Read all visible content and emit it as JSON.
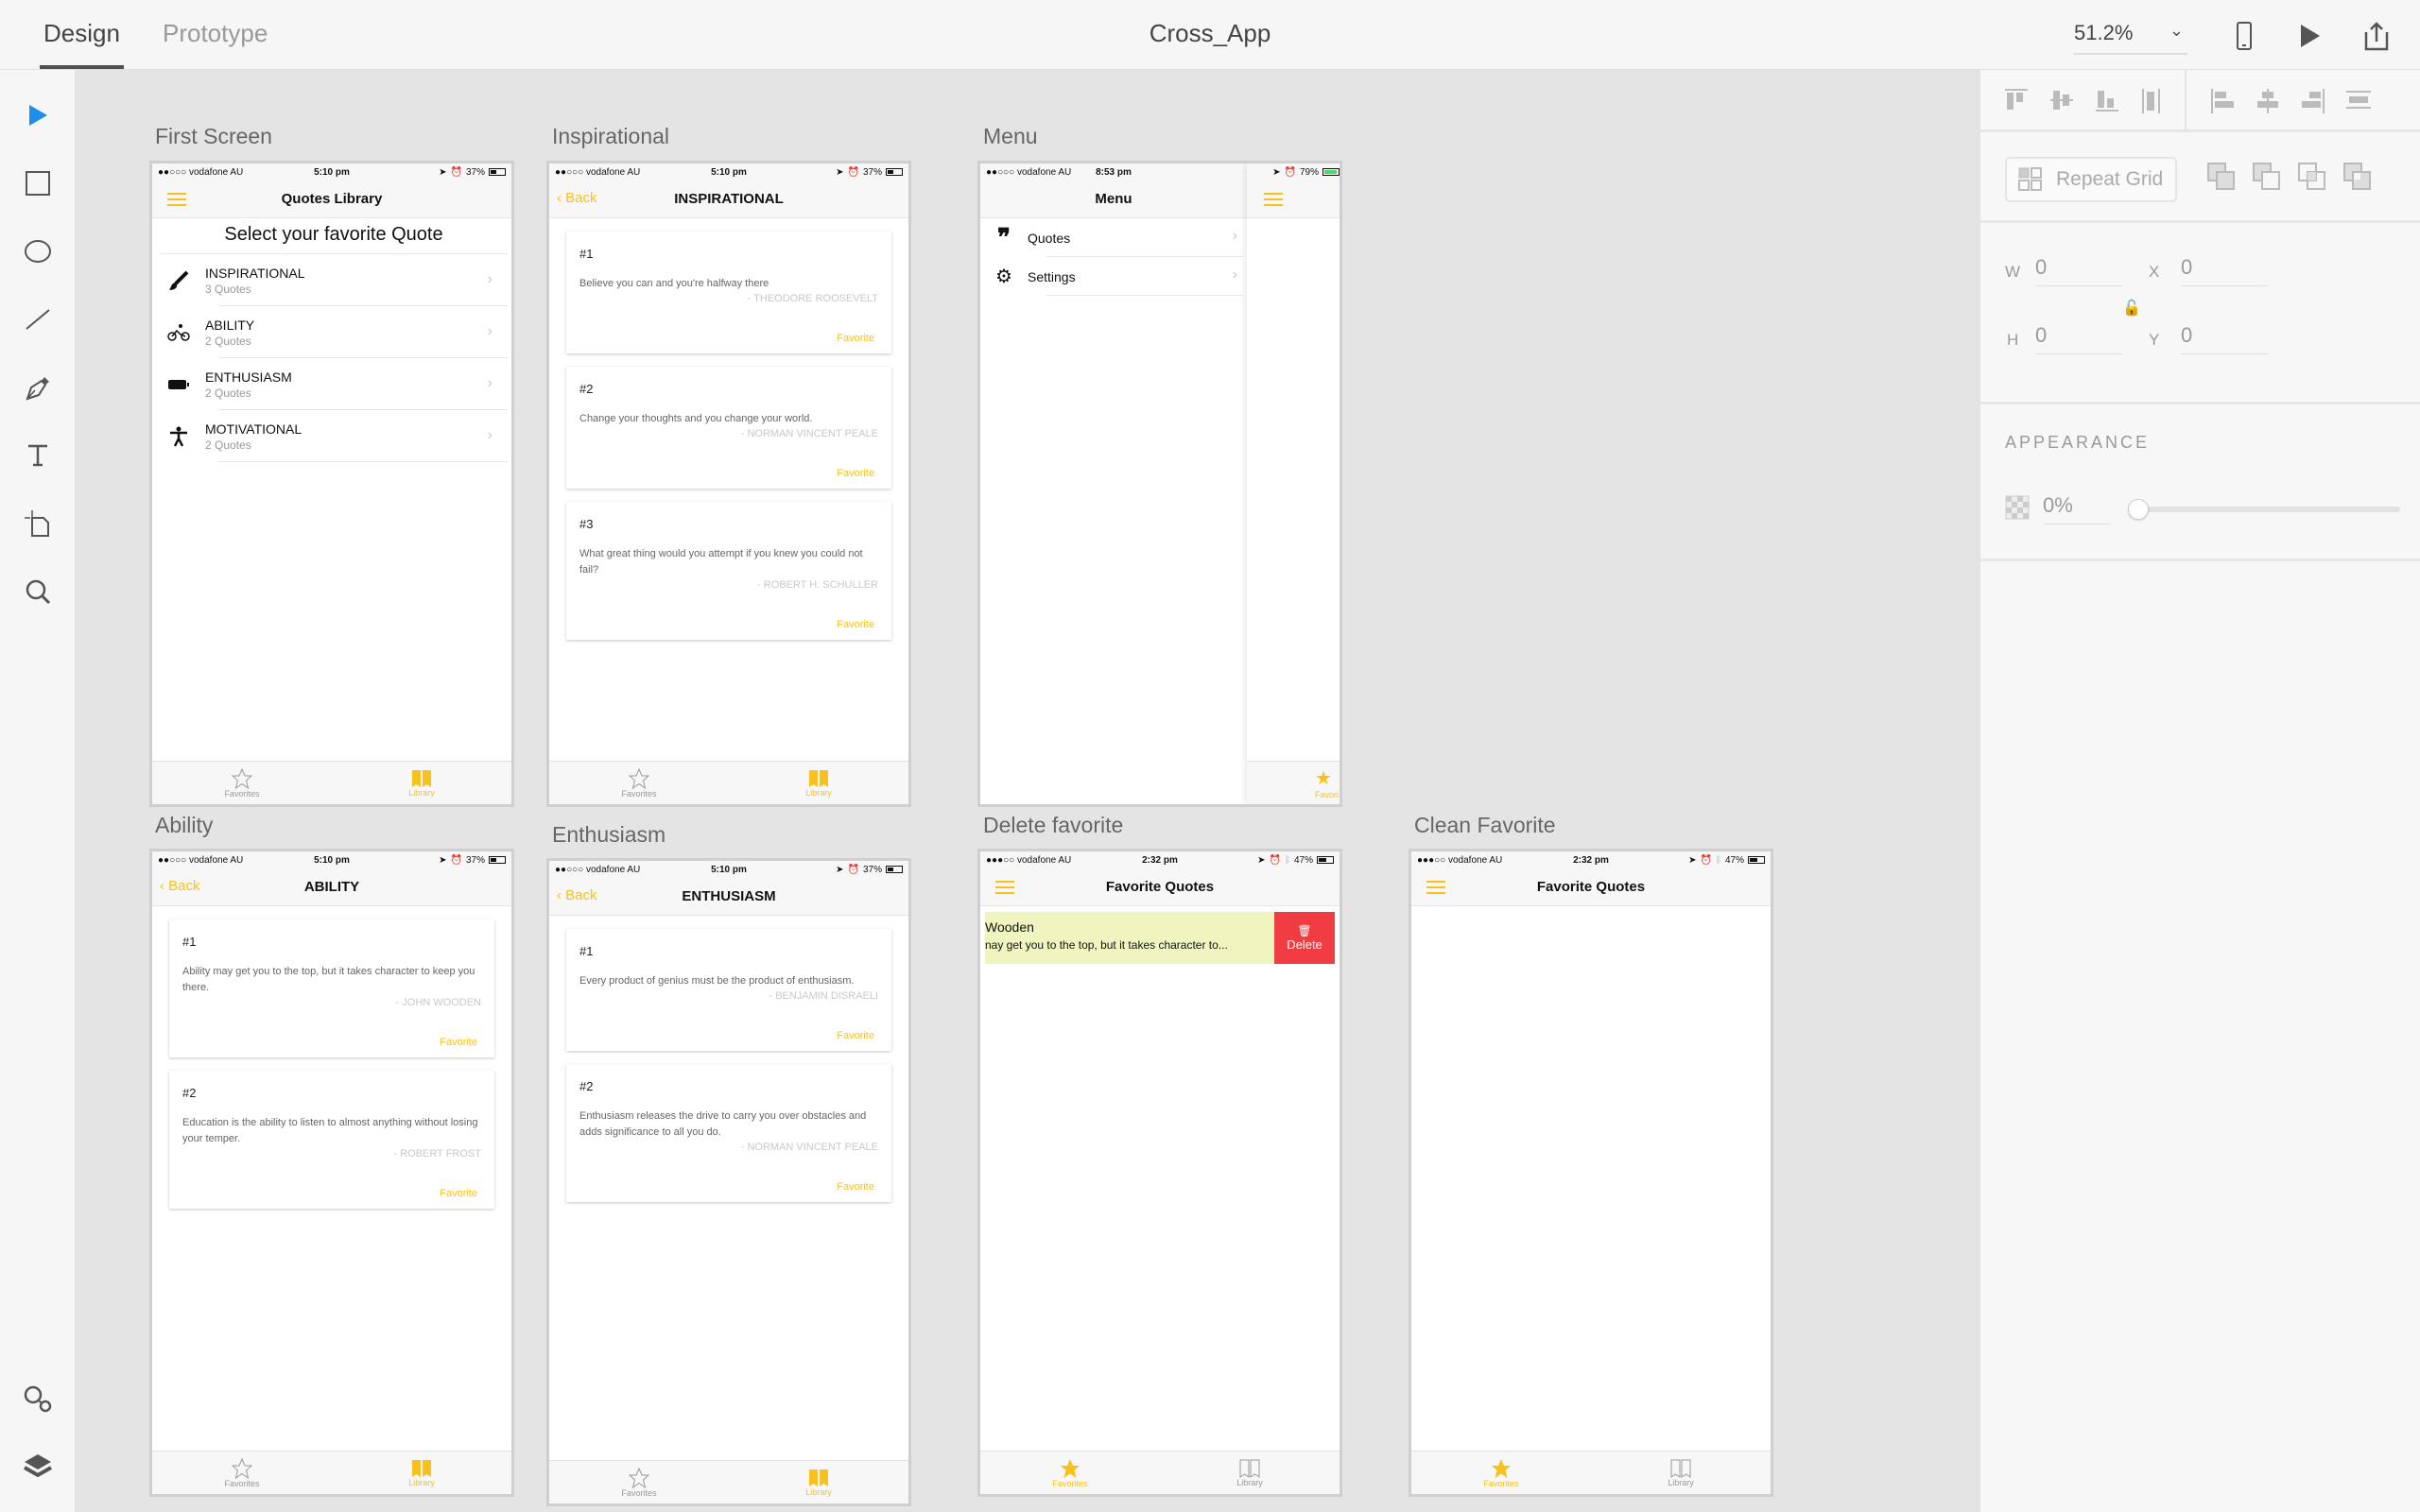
{
  "app": {
    "tabs": [
      "Design",
      "Prototype"
    ],
    "active_tab": "Design",
    "document_title": "Cross_App",
    "zoom_level": "51.2%"
  },
  "topbar_icons": [
    "device-preview-icon",
    "play-icon",
    "share-icon"
  ],
  "tools": [
    "select-tool",
    "rectangle-tool",
    "ellipse-tool",
    "line-tool",
    "pen-tool",
    "text-tool",
    "artboard-tool",
    "zoom-tool"
  ],
  "tools_bottom": [
    "assets-icon",
    "layers-icon"
  ],
  "panel": {
    "repeat_grid": "Repeat Grid",
    "w_label": "W",
    "w_value": "0",
    "h_label": "H",
    "h_value": "0",
    "x_label": "X",
    "x_value": "0",
    "y_label": "Y",
    "y_value": "0",
    "appearance_label": "APPEARANCE",
    "opacity": "0%",
    "opacity_fraction": 0
  },
  "accent_color": "#f8c11e",
  "delete_color": "#f23c43",
  "artboards": {
    "first": {
      "label": "First Screen",
      "status": {
        "carrier": "●●○○○ vodafone AU",
        "time": "5:10 pm",
        "battery": "37%"
      },
      "nav_title": "Quotes Library",
      "heading": "Select your favorite Quote",
      "categories": [
        {
          "name": "INSPIRATIONAL",
          "count": "3 Quotes",
          "icon": "paintbrush-icon"
        },
        {
          "name": "ABILITY",
          "count": "2 Quotes",
          "icon": "bicycle-icon"
        },
        {
          "name": "ENTHUSIASM",
          "count": "2 Quotes",
          "icon": "battery-icon"
        },
        {
          "name": "MOTIVATIONAL",
          "count": "2 Quotes",
          "icon": "person-icon"
        }
      ],
      "tabbar": {
        "favorites": "Favorites",
        "library": "Library"
      }
    },
    "inspirational": {
      "label": "Inspirational",
      "status": {
        "carrier": "●●○○○ vodafone AU",
        "time": "5:10 pm",
        "battery": "37%"
      },
      "back": "Back",
      "nav_title": "INSPIRATIONAL",
      "quotes": [
        {
          "num": "#1",
          "text": "Believe you can and you're halfway there",
          "author": "- THEODORE ROOSEVELT",
          "fav": "Favorite"
        },
        {
          "num": "#2",
          "text": "Change your thoughts and you change your world.",
          "author": "- NORMAN VINCENT PEALE",
          "fav": "Favorite"
        },
        {
          "num": "#3",
          "text": "What great thing would you attempt if you knew you could not fail?",
          "author": "- ROBERT H. SCHULLER",
          "fav": "Favorite"
        }
      ],
      "tabbar": {
        "favorites": "Favorites",
        "library": "Library"
      }
    },
    "menu": {
      "label": "Menu",
      "status": {
        "carrier": "●●○○○ vodafone AU",
        "time": "8:53 pm",
        "battery": "79%"
      },
      "nav_title": "Menu",
      "items": [
        {
          "label": "Quotes",
          "icon": "quote-icon"
        },
        {
          "label": "Settings",
          "icon": "gear-icon"
        }
      ],
      "peek_tab": "Favori"
    },
    "ability": {
      "label": "Ability",
      "status": {
        "carrier": "●●○○○ vodafone AU",
        "time": "5:10 pm",
        "battery": "37%"
      },
      "back": "Back",
      "nav_title": "ABILITY",
      "quotes": [
        {
          "num": "#1",
          "text": "Ability may get you to the top, but it takes character to keep you there.",
          "author": "- JOHN WOODEN",
          "fav": "Favorite"
        },
        {
          "num": "#2",
          "text": "Education is the ability to listen to almost anything without losing your temper.",
          "author": "- ROBERT FROST",
          "fav": "Favorite"
        }
      ],
      "tabbar": {
        "favorites": "Favorites",
        "library": "Library"
      }
    },
    "enthusiasm": {
      "label": "Enthusiasm",
      "status": {
        "carrier": "●●○○○ vodafone AU",
        "time": "5:10 pm",
        "battery": "37%"
      },
      "back": "Back",
      "nav_title": "ENTHUSIASM",
      "quotes": [
        {
          "num": "#1",
          "text": "Every product of genius must be the product of enthusiasm.",
          "author": "- BENJAMIN DISRAELI",
          "fav": "Favorite"
        },
        {
          "num": "#2",
          "text": "Enthusiasm releases the drive to carry you over obstacles and adds significance to all you do.",
          "author": "- NORMAN VINCENT PEALE",
          "fav": "Favorite"
        }
      ],
      "tabbar": {
        "favorites": "Favorites",
        "library": "Library"
      }
    },
    "delete": {
      "label": "Delete favorite",
      "status": {
        "carrier": "●●●○○ vodafone AU",
        "time": "2:32 pm",
        "battery": "47%"
      },
      "nav_title": "Favorite Quotes",
      "row_title": "Wooden",
      "row_text": "nay get you to the top, but it takes character to...",
      "delete_label": "Delete",
      "tabbar": {
        "favorites": "Favorites",
        "library": "Library"
      }
    },
    "clean": {
      "label": "Clean Favorite",
      "status": {
        "carrier": "●●●○○ vodafone AU",
        "time": "2:32 pm",
        "battery": "47%"
      },
      "nav_title": "Favorite Quotes",
      "tabbar": {
        "favorites": "Favorites",
        "library": "Library"
      }
    }
  }
}
